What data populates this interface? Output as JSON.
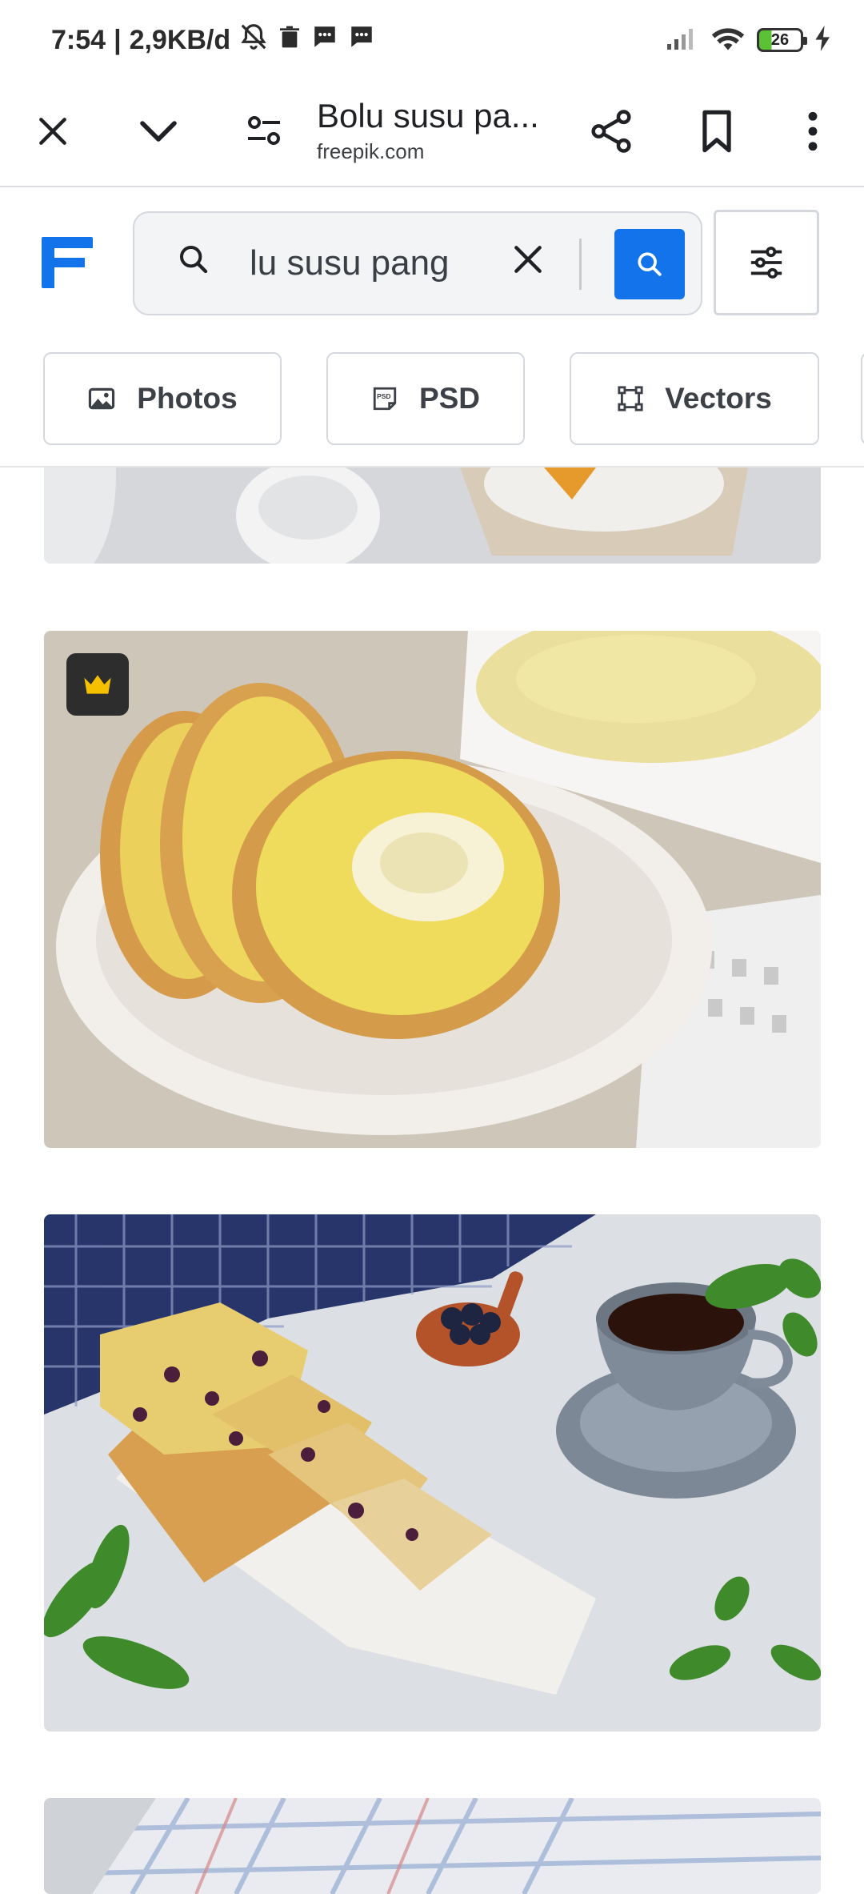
{
  "status_bar": {
    "time": "7:54",
    "separator": "|",
    "network_speed": "2,9KB/d",
    "battery_level": "26",
    "icons": [
      "bell-off-icon",
      "trash-icon",
      "message-icon",
      "message-icon",
      "signal-icon",
      "wifi-icon",
      "battery-icon",
      "charging-icon"
    ]
  },
  "tab_toolbar": {
    "title": "Bolu susu pa...",
    "domain": "freepik.com",
    "icons": [
      "close-icon",
      "chevron-down-icon",
      "page-settings-icon",
      "share-icon",
      "bookmark-icon",
      "more-vert-icon"
    ]
  },
  "search": {
    "query": "lu susu pang",
    "icons": [
      "search-icon",
      "clear-icon",
      "search-submit-icon",
      "filters-icon"
    ]
  },
  "filter_chips": [
    {
      "label": "Photos",
      "icon": "photo-icon"
    },
    {
      "label": "PSD",
      "icon": "psd-icon"
    },
    {
      "label": "Vectors",
      "icon": "vector-icon"
    }
  ],
  "colors": {
    "brand_blue": "#1273eb",
    "premium_crown": "#f5c000"
  }
}
